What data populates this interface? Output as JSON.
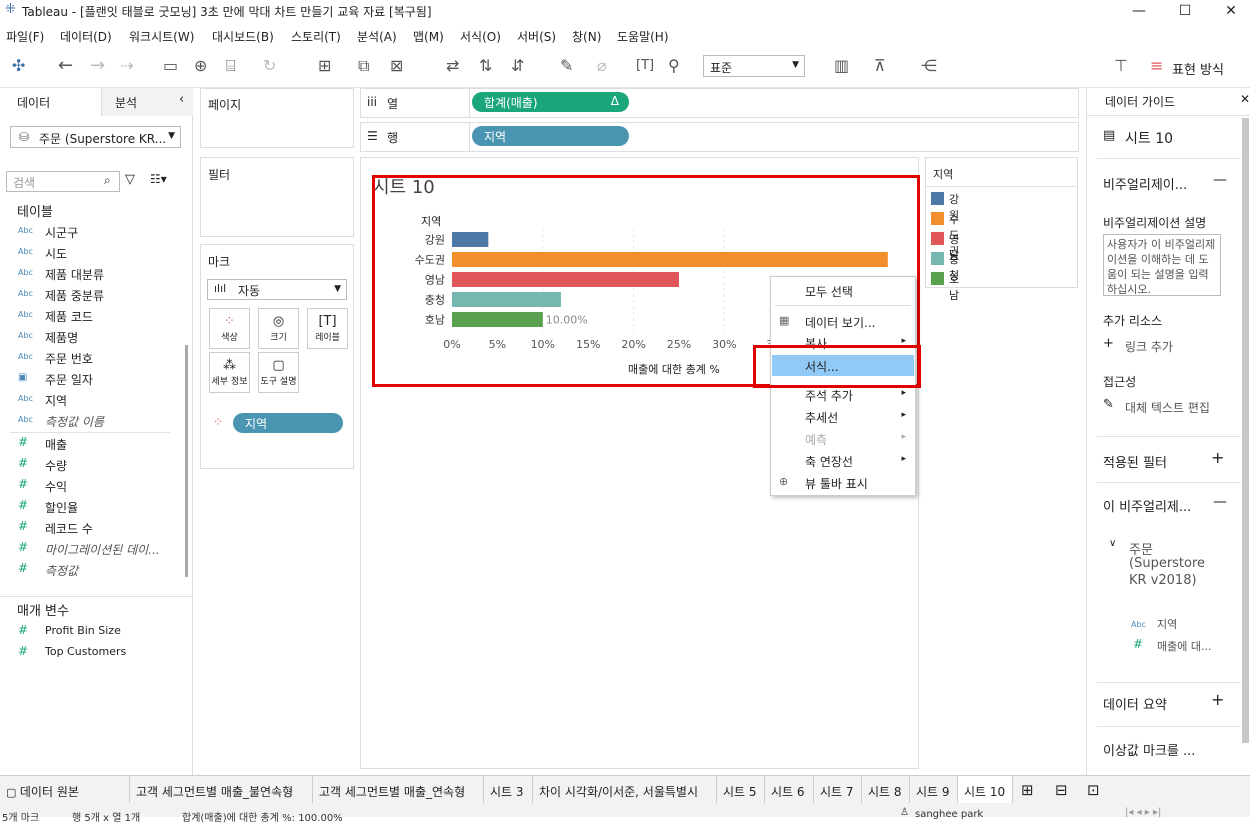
{
  "window": {
    "title": "Tableau - [플랜잇 태블로 굿모닝] 3초 만에 막대 차트 만들기 교육 자료 [복구됨]",
    "minimize": "—",
    "maximize": "☐",
    "close": "✕"
  },
  "menu": [
    "파일(F)",
    "데이터(D)",
    "워크시트(W)",
    "대시보드(B)",
    "스토리(T)",
    "분석(A)",
    "맵(M)",
    "서식(O)",
    "서버(S)",
    "창(N)",
    "도움말(H)"
  ],
  "toolbar": {
    "fit_select": "표준",
    "show_me": "표현 방식"
  },
  "left": {
    "tab_data": "데이터",
    "tab_analysis": "분석",
    "datasource": "주문 (Superstore KR...",
    "search_placeholder": "검색",
    "tables_header": "테이블",
    "dimensions": [
      {
        "type": "Abc",
        "name": "시군구"
      },
      {
        "type": "Abc",
        "name": "시도"
      },
      {
        "type": "Abc",
        "name": "제품 대분류"
      },
      {
        "type": "Abc",
        "name": "제품 중분류"
      },
      {
        "type": "Abc",
        "name": "제품 코드"
      },
      {
        "type": "Abc",
        "name": "제품명"
      },
      {
        "type": "Abc",
        "name": "주문 번호"
      },
      {
        "type": "date",
        "name": "주문 일자"
      },
      {
        "type": "Abc",
        "name": "지역"
      },
      {
        "type": "Abc",
        "name": "측정값 이름"
      }
    ],
    "measures": [
      {
        "name": "매출"
      },
      {
        "name": "수량"
      },
      {
        "name": "수익"
      },
      {
        "name": "할인율"
      },
      {
        "name": "레코드 수"
      },
      {
        "name": "마이그레이션된 데이..."
      },
      {
        "name": "측정값"
      }
    ],
    "params_header": "매개 변수",
    "params": [
      {
        "name": "Profit Bin Size"
      },
      {
        "name": "Top Customers"
      }
    ]
  },
  "cards": {
    "pages": "페이지",
    "filters": "필터",
    "marks": "마크",
    "mark_type": "자동",
    "mark_buttons": [
      {
        "label": "색상",
        "icon": "color-icon"
      },
      {
        "label": "크기",
        "icon": "size-icon"
      },
      {
        "label": "레이블",
        "icon": "label-icon"
      },
      {
        "label": "세부 정보",
        "icon": "detail-icon"
      },
      {
        "label": "도구 설명",
        "icon": "tooltip-icon"
      }
    ],
    "mark_pill": "지역"
  },
  "shelves": {
    "columns_label": "열",
    "rows_label": "행",
    "columns_pill": "합계(매출)",
    "columns_delta": "Δ",
    "rows_pill": "지역"
  },
  "sheet": {
    "title": "시트 10",
    "row_header": "지역",
    "x_title": "매출에 대한 총계 %",
    "bar_label": "10.00%"
  },
  "chart_data": {
    "type": "bar",
    "orientation": "horizontal",
    "categories": [
      "강원",
      "수도권",
      "영남",
      "충청",
      "호남"
    ],
    "values": [
      4,
      48,
      25,
      12,
      10
    ],
    "xlim": [
      0,
      50
    ],
    "x_ticks": [
      "0%",
      "5%",
      "10%",
      "15%",
      "20%",
      "25%",
      "30%",
      "3"
    ],
    "colors": [
      "#4e79a7",
      "#f28e2b",
      "#e15759",
      "#76b7b2",
      "#59a14f"
    ],
    "xlabel": "매출에 대한 총계 %",
    "ylabel": "지역",
    "title": "시트 10"
  },
  "legend": {
    "title": "지역",
    "items": [
      {
        "label": "강원",
        "color": "#4e79a7"
      },
      {
        "label": "수도권",
        "color": "#f28e2b"
      },
      {
        "label": "영남",
        "color": "#e15759"
      },
      {
        "label": "충청",
        "color": "#76b7b2"
      },
      {
        "label": "호남",
        "color": "#59a14f"
      }
    ]
  },
  "context_menu": [
    {
      "label": "모두 선택"
    },
    {
      "label": "데이터 보기...",
      "icon": "grid-icon"
    },
    {
      "label": "복사",
      "sub": "▸"
    },
    {
      "label": "서식...",
      "highlight": true
    },
    {
      "label": "주석 추가",
      "sub": "▸"
    },
    {
      "label": "추세선",
      "sub": "▸"
    },
    {
      "label": "예측",
      "sub": "▸",
      "disabled": true
    },
    {
      "label": "축 연장선",
      "sub": "▸"
    },
    {
      "label": "뷰 툴바 표시",
      "icon": "zoom-icon"
    }
  ],
  "right": {
    "header": "데이터 가이드",
    "sheet": "시트 10",
    "viz_section": "비주얼리제이...",
    "viz_desc_label": "비주얼리제이션 설명",
    "viz_desc_placeholder": "사용자가 이 비주얼리제이션을 이해하는 데 도움이 되는 설명을 입력하십시오.",
    "resources": "추가 리소스",
    "add_link": "링크 추가",
    "accessibility": "접근성",
    "alt_text": "대체 텍스트 편집",
    "applied_filters": "적용된 필터",
    "this_viz": "이 비주얼리제...",
    "datasource_l1": "주문",
    "datasource_l2": "(Superstore",
    "datasource_l3": "KR v2018)",
    "field1": "지역",
    "field2": "매출에 대...",
    "data_summary": "데이터 요약",
    "outliers": "이상값 마크를 ..."
  },
  "tabs": [
    "데이터 원본",
    "고객 세그먼트별 매출_불연속형",
    "고객 세그먼트별 매출_연속형",
    "시트 3",
    "차이 시각화/이서준, 서울특별시",
    "시트 5",
    "시트 6",
    "시트 7",
    "시트 8",
    "시트 9",
    "시트 10"
  ],
  "status": {
    "left": "5개 마크",
    "rows": "행 5개 x 열 1개",
    "sum": "합계(매출)에 대한 총계 %: 100.00%",
    "user": "sanghee park"
  }
}
